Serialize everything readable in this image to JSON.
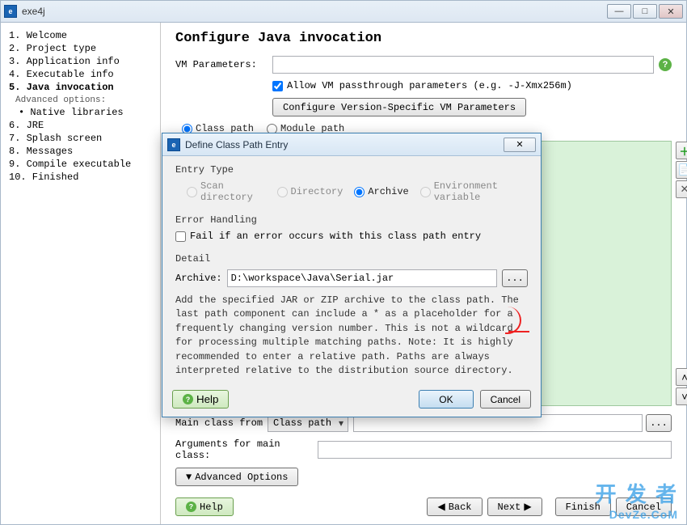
{
  "window": {
    "title": "exe4j",
    "icon_text": "e"
  },
  "sidebar": {
    "advanced_label": "Advanced options:",
    "advanced_sub": "Native libraries",
    "items": [
      {
        "label": "1. Welcome"
      },
      {
        "label": "2. Project type"
      },
      {
        "label": "3. Application info"
      },
      {
        "label": "4. Executable info"
      },
      {
        "label": "5. Java invocation",
        "current": true
      },
      {
        "label": "6. JRE"
      },
      {
        "label": "7. Splash screen"
      },
      {
        "label": "8. Messages"
      },
      {
        "label": "9. Compile executable"
      },
      {
        "label": "10. Finished"
      }
    ]
  },
  "main": {
    "title": "Configure Java invocation",
    "vm_label": "VM Parameters:",
    "vm_value": "",
    "allow_passthrough": "Allow VM passthrough parameters (e.g. -J-Xmx256m)",
    "configure_vm_btn": "Configure Version-Specific VM Parameters",
    "classpath_radio": "Class path",
    "modulepath_radio": "Module path",
    "main_class_label": "Main class from",
    "main_class_select": "Class path",
    "main_class_value": "",
    "args_label": "Arguments for main class:",
    "args_value": "",
    "advanced_btn": "Advanced Options",
    "help": "Help",
    "back": "Back",
    "next": "Next",
    "finish": "Finish",
    "cancel": "Cancel"
  },
  "modal": {
    "title": "Define Class Path Entry",
    "entry_type_label": "Entry Type",
    "scan_dir": "Scan directory",
    "directory": "Directory",
    "archive": "Archive",
    "env_var": "Environment variable",
    "error_label": "Error Handling",
    "fail_chk": "Fail if an error occurs with this class path entry",
    "detail_label": "Detail",
    "archive_label": "Archive:",
    "archive_value": "D:\\workspace\\Java\\Serial.jar",
    "help_text": "Add the specified JAR or ZIP archive to the class path. The last path component can include a * as a placeholder for a frequently changing version number. This is not a wildcard for processing multiple matching paths. Note: It is highly recommended to enter a relative path. Paths are always interpreted relative to the distribution source directory.",
    "help": "Help",
    "ok": "OK",
    "cancel": "Cancel"
  },
  "watermark": "exe4j",
  "dev": {
    "big": "开 发 者",
    "small": "DevZe.CoM"
  }
}
